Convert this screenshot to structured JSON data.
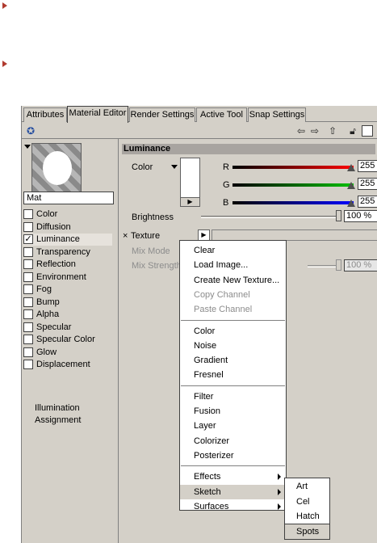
{
  "tabs": [
    "Attributes",
    "Material Editor",
    "Render Settings",
    "Active Tool",
    "Snap Settings"
  ],
  "toolbar": {
    "icons": [
      "pin-icon",
      "arrow-left-icon",
      "arrow-right-icon",
      "arrow-up-icon",
      "lock-icon",
      "new-panel-icon"
    ]
  },
  "material": {
    "name": "Mat"
  },
  "channels": [
    {
      "label": "Color",
      "checked": false
    },
    {
      "label": "Diffusion",
      "checked": false
    },
    {
      "label": "Luminance",
      "checked": true
    },
    {
      "label": "Transparency",
      "checked": false
    },
    {
      "label": "Reflection",
      "checked": false
    },
    {
      "label": "Environment",
      "checked": false
    },
    {
      "label": "Fog",
      "checked": false
    },
    {
      "label": "Bump",
      "checked": false
    },
    {
      "label": "Alpha",
      "checked": false
    },
    {
      "label": "Specular",
      "checked": false
    },
    {
      "label": "Specular Color",
      "checked": false
    },
    {
      "label": "Glow",
      "checked": false
    },
    {
      "label": "Displacement",
      "checked": false
    }
  ],
  "extra_items": [
    "Illumination",
    "Assignment"
  ],
  "panel": {
    "section_title": "Luminance",
    "color_label": "Color",
    "r_label": "R",
    "g_label": "G",
    "b_label": "B",
    "r_value": "255",
    "g_value": "255",
    "b_value": "255",
    "brightness_label": "Brightness",
    "brightness_value": "100 %",
    "texture_label": "Texture",
    "mix_mode_label": "Mix Mode",
    "mix_strength_label": "Mix Strength",
    "mix_strength_value": "100 %",
    "dots_label": "...",
    "texture_x": "×"
  },
  "levels": {
    "r": 1.0,
    "g": 1.0,
    "b": 1.0,
    "brightness": 1.0
  },
  "colors": {
    "r": "#ff0000",
    "g": "#00c000",
    "b": "#0000ff",
    "bullet": "#b03a2e"
  },
  "context_menu": {
    "group1": [
      {
        "label": "Clear",
        "disabled": false
      },
      {
        "label": "Load Image...",
        "disabled": false
      },
      {
        "label": "Create New Texture...",
        "disabled": false
      },
      {
        "label": "Copy Channel",
        "disabled": true
      },
      {
        "label": "Paste Channel",
        "disabled": true
      }
    ],
    "group2": [
      "Color",
      "Noise",
      "Gradient",
      "Fresnel"
    ],
    "group3": [
      "Filter",
      "Fusion",
      "Layer",
      "Colorizer",
      "Posterizer"
    ],
    "group4": [
      "Effects",
      "Sketch",
      "Surfaces"
    ]
  },
  "submenu": [
    "Art",
    "Cel",
    "Hatch",
    "Spots"
  ]
}
